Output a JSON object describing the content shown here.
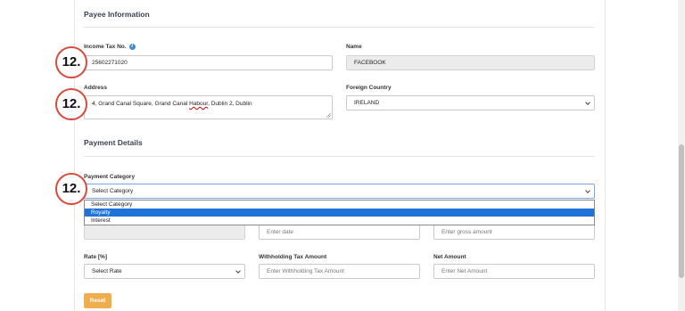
{
  "payee": {
    "section_title": "Payee Information",
    "income_tax_label": "Income Tax No.",
    "income_tax_value": "25602271020",
    "name_label": "Name",
    "name_value": "FACEBOOK",
    "address_label": "Address",
    "address_value_pre": "4, Grand Canal Square, Grand Canal ",
    "address_value_err": "Habour",
    "address_value_post": ", Dublin 2, Dublin",
    "country_label": "Foreign Country",
    "country_value": "IRELAND"
  },
  "payment": {
    "section_title": "Payment Details",
    "category_label": "Payment Category",
    "category_value": "Select Category",
    "category_options": [
      "Select Category",
      "Royalty",
      "Interest"
    ],
    "date_placeholder": "Enter date",
    "gross_placeholder": "Enter gross amount",
    "rate_label": "Rate [%]",
    "rate_value": "Select Rate",
    "wht_label": "Withholding Tax Amount",
    "wht_placeholder": "Enter Withholding Tax Amount",
    "net_label": "Net Amount",
    "net_placeholder": "Enter Net Amount",
    "reset_label": "Reset"
  },
  "annotations": {
    "step_badge": "12."
  },
  "colors": {
    "accent": "#f0ad4e",
    "badge_border": "#d94a3a",
    "selected": "#1e73d9",
    "info": "#3d8bd9"
  }
}
